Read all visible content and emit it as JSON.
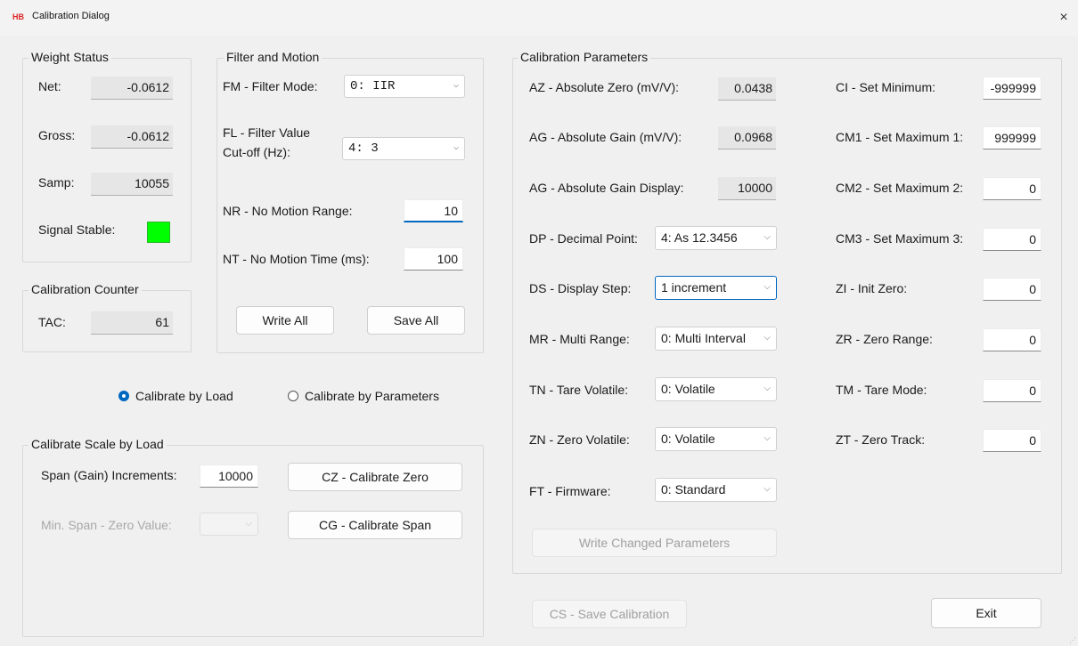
{
  "window": {
    "logo": "HB",
    "title": "Calibration Dialog",
    "close": "×"
  },
  "weight_status": {
    "legend": "Weight Status",
    "net_label": "Net:",
    "net_value": "-0.0612",
    "gross_label": "Gross:",
    "gross_value": "-0.0612",
    "samp_label": "Samp:",
    "samp_value": "10055",
    "stable_label": "Signal Stable:",
    "stable_color": "#00ff00"
  },
  "calibration_counter": {
    "legend": "Calibration Counter",
    "tac_label": "TAC:",
    "tac_value": "61"
  },
  "filter_motion": {
    "legend": "Filter and Motion",
    "fm_label": "FM - Filter Mode:",
    "fm_value": "0: IIR",
    "fl_label_line1": "FL - Filter Value",
    "fl_label_line2": "Cut-off (Hz):",
    "fl_value": "4:  3",
    "nr_label": "NR - No Motion Range:",
    "nr_value": "10",
    "nt_label": "NT - No Motion Time (ms):",
    "nt_value": "100",
    "write_all": "Write All",
    "save_all": "Save All"
  },
  "calibrate_mode": {
    "by_load": "Calibrate by Load",
    "by_params": "Calibrate by Parameters",
    "selected": "by_load"
  },
  "calibrate_load": {
    "legend": "Calibrate Scale by Load",
    "span_label": "Span (Gain) Increments:",
    "span_value": "10000",
    "cz_button": "CZ - Calibrate Zero",
    "min_span_label": "Min. Span - Zero Value:",
    "min_span_value": "",
    "cg_button": "CG - Calibrate Span"
  },
  "cal_params": {
    "legend": "Calibration Parameters",
    "az_label": "AZ - Absolute Zero (mV/V):",
    "az_value": "0.0438",
    "ag_label": "AG - Absolute Gain (mV/V):",
    "ag_value": "0.0968",
    "agd_label": "AG - Absolute Gain Display:",
    "agd_value": "10000",
    "dp_label": "DP - Decimal Point:",
    "dp_value": "4: As 12.3456",
    "ds_label": "DS - Display Step:",
    "ds_value": "1 increment",
    "mr_label": "MR - Multi Range:",
    "mr_value": "0: Multi Interval",
    "tn_label": "TN - Tare Volatile:",
    "tn_value": "0: Volatile",
    "zn_label": "ZN - Zero Volatile:",
    "zn_value": "0: Volatile",
    "ft_label": "FT - Firmware:",
    "ft_value": "0: Standard",
    "ci_label": "CI - Set Minimum:",
    "ci_value": "-999999",
    "cm1_label": "CM1 - Set Maximum 1:",
    "cm1_value": "999999",
    "cm2_label": "CM2 - Set Maximum 2:",
    "cm2_value": "0",
    "cm3_label": "CM3 - Set Maximum 3:",
    "cm3_value": "0",
    "zi_label": "ZI - Init Zero:",
    "zi_value": "0",
    "zr_label": "ZR - Zero Range:",
    "zr_value": "0",
    "tm_label": "TM - Tare Mode:",
    "tm_value": "0",
    "zt_label": "ZT - Zero Track:",
    "zt_value": "0",
    "write_changed": "Write Changed Parameters"
  },
  "footer": {
    "save_cal": "CS - Save Calibration",
    "exit": "Exit"
  },
  "icons": {
    "chevron": "⌵",
    "grip": "⋰"
  },
  "colors": {
    "accent": "#0067c0",
    "stable": "#00ff00",
    "disabled_text": "#a0a0a0"
  }
}
